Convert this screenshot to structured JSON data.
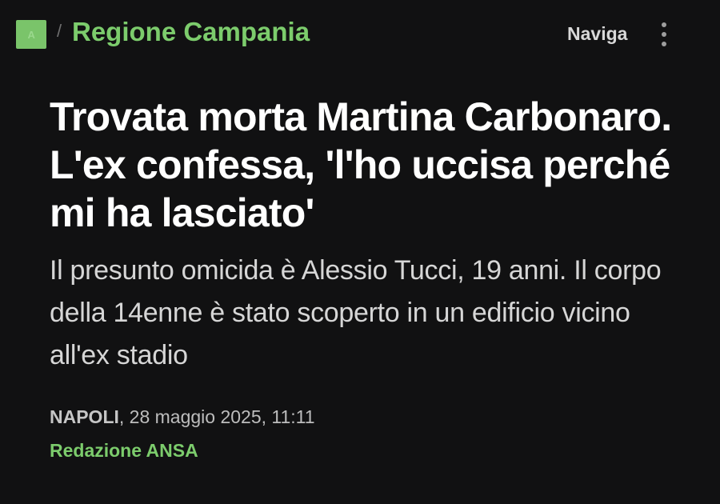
{
  "header": {
    "logo_icon": "ansa-logo-icon",
    "breadcrumb_separator": "/",
    "section": "Regione Campania",
    "nav_label": "Naviga",
    "menu_icon": "more-vertical-icon"
  },
  "article": {
    "headline": "Trovata morta Martina Carbonaro. L'ex confessa, 'l'ho uccisa perché mi ha lasciato'",
    "summary": "Il presunto omicida è Alessio Tucci, 19 anni. Il corpo della 14enne è stato scoperto in un edificio vicino all'ex stadio",
    "dateline_city": "NAPOLI",
    "dateline_date": ", 28 maggio 2025, 11:11",
    "author": "Redazione ANSA"
  },
  "colors": {
    "background": "#111112",
    "accent_green": "#7ccc6c",
    "headline": "#ffffff",
    "body_text": "#d6d6d6"
  }
}
